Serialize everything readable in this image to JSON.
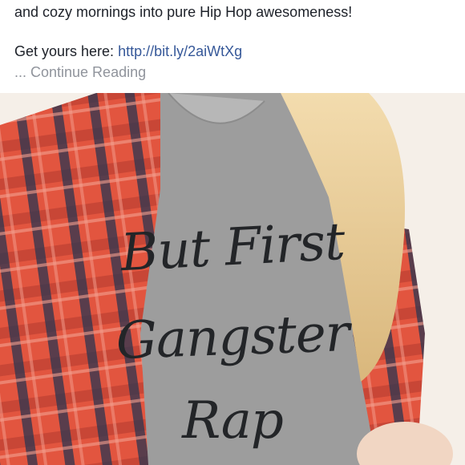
{
  "post": {
    "line1": "and cozy mornings into pure Hip Hop awesomeness!",
    "get_yours_prefix": "Get yours here: ",
    "link_text": "http://bit.ly/2aiWtXg",
    "continue_reading": "... Continue Reading"
  },
  "photo": {
    "shirt_line1": "But First",
    "shirt_line2": "Gangster",
    "shirt_line3": "Rap"
  },
  "colors": {
    "text": "#1d2129",
    "link": "#365899",
    "muted": "#90949c",
    "plaid_red": "#e2553f",
    "shirt_gray": "#9a9a9a"
  }
}
